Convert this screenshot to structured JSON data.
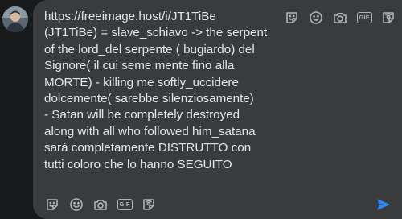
{
  "comment": {
    "lines": [
      "https://freeimage.host/i/JT1TiBe",
      "(JT1TiBe) = slave_schiavo -> the serpent",
      "of the lord_del serpente ( bugiardo) del",
      "Signore( il cui seme mente fino alla",
      "MORTE) - killing me softly_uccidere",
      "dolcemente( sarebbe silenziosamente)",
      "- Satan will be completely destroyed",
      "along with all who followed him_satana",
      "sarà completamente DISTRUTTO con",
      "tutti coloro che lo hanno SEGUITO"
    ]
  },
  "toolbar": {
    "gif_label": "GIF",
    "icons": [
      "sticker-icon",
      "emoji-icon",
      "camera-icon",
      "gif-icon",
      "avatar-sticker-icon"
    ]
  },
  "send": {
    "icon": "send-icon"
  },
  "colors": {
    "background": "#18191a",
    "composer": "#3a3b3c",
    "text": "#e4e6eb",
    "icon": "#b0b3b8",
    "send": "#2d88ff"
  }
}
